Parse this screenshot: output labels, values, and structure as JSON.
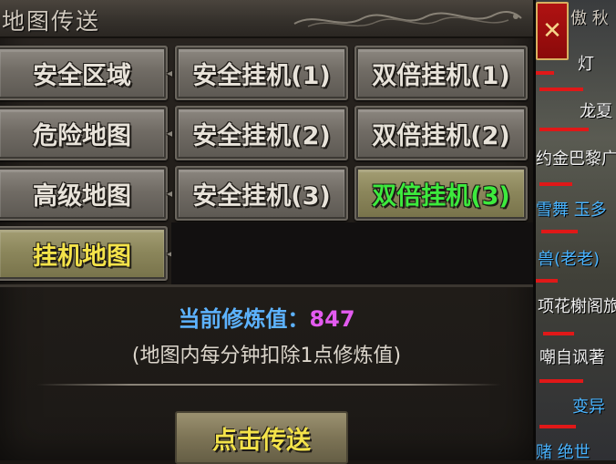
{
  "window": {
    "title": "地图传送",
    "close_glyph": "✕"
  },
  "left_tabs": [
    {
      "label": "安全区域",
      "selected": false
    },
    {
      "label": "危险地图",
      "selected": false
    },
    {
      "label": "高级地图",
      "selected": false
    },
    {
      "label": "挂机地图",
      "selected": true
    }
  ],
  "maps": [
    [
      "安全挂机(1)",
      "双倍挂机(1)"
    ],
    [
      "安全挂机(2)",
      "双倍挂机(2)"
    ],
    [
      "安全挂机(3)",
      "双倍挂机(3)"
    ]
  ],
  "selected_map": "双倍挂机(3)",
  "cultivation": {
    "label": "当前修炼值：",
    "value": "847"
  },
  "note": "(地图内每分钟扣除1点修炼值)",
  "teleport_label": "点击传送",
  "side_list": {
    "top_text": "傲 秋",
    "items": [
      "灯",
      "龙夏",
      "约金巴黎广",
      "雪舞 玉多",
      "兽(老老)",
      "项花榭阁旅",
      "嘲自讽著",
      "变异",
      "赌 绝世"
    ]
  },
  "colors": {
    "cultivation_label": "#5db3ff",
    "cultivation_value": "#e35bf0",
    "selected_text": "#3dea3d",
    "active_tab_text": "#f4e34a"
  }
}
